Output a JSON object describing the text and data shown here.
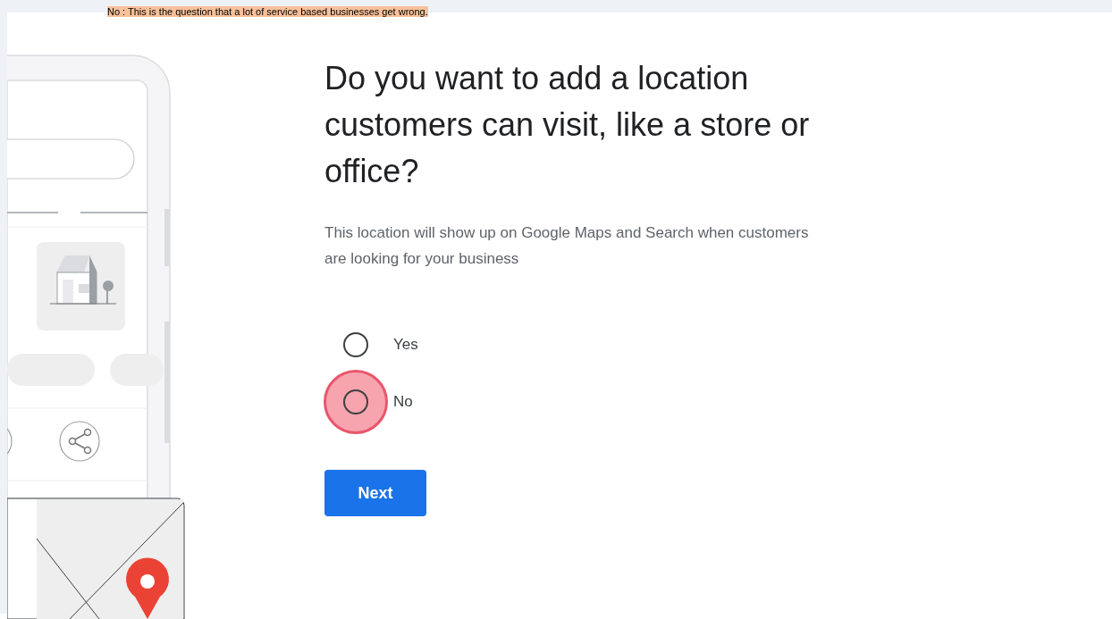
{
  "caption": {
    "text": "No : This is the question that a lot of service based businesses get wrong."
  },
  "heading": "Do you want to add a location customers can visit, like a store or office?",
  "description": "This location will show up on Google Maps and Search when customers are looking for your business",
  "options": [
    {
      "label": "Yes",
      "selected": false,
      "highlighted": false
    },
    {
      "label": "No",
      "selected": false,
      "highlighted": true
    }
  ],
  "button": "Next"
}
